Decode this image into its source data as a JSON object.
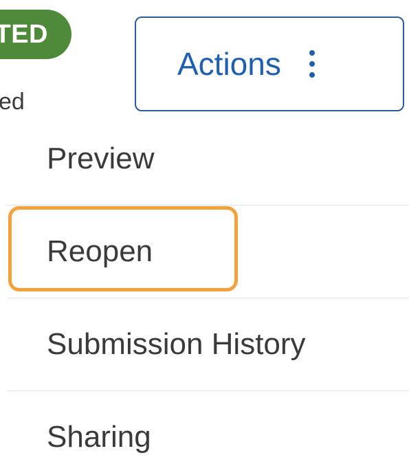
{
  "status": {
    "badge_label": "TED",
    "badge_color": "#4f8a3b",
    "subtext": "ed"
  },
  "actions_button": {
    "label": "Actions",
    "icon": "kebab-vertical-icon",
    "accent_color": "#1f5fb0"
  },
  "menu": {
    "items": [
      {
        "label": "Preview"
      },
      {
        "label": "Reopen",
        "highlighted": true
      },
      {
        "label": "Submission History"
      },
      {
        "label": "Sharing"
      }
    ],
    "highlight_color": "#f3a23b"
  }
}
